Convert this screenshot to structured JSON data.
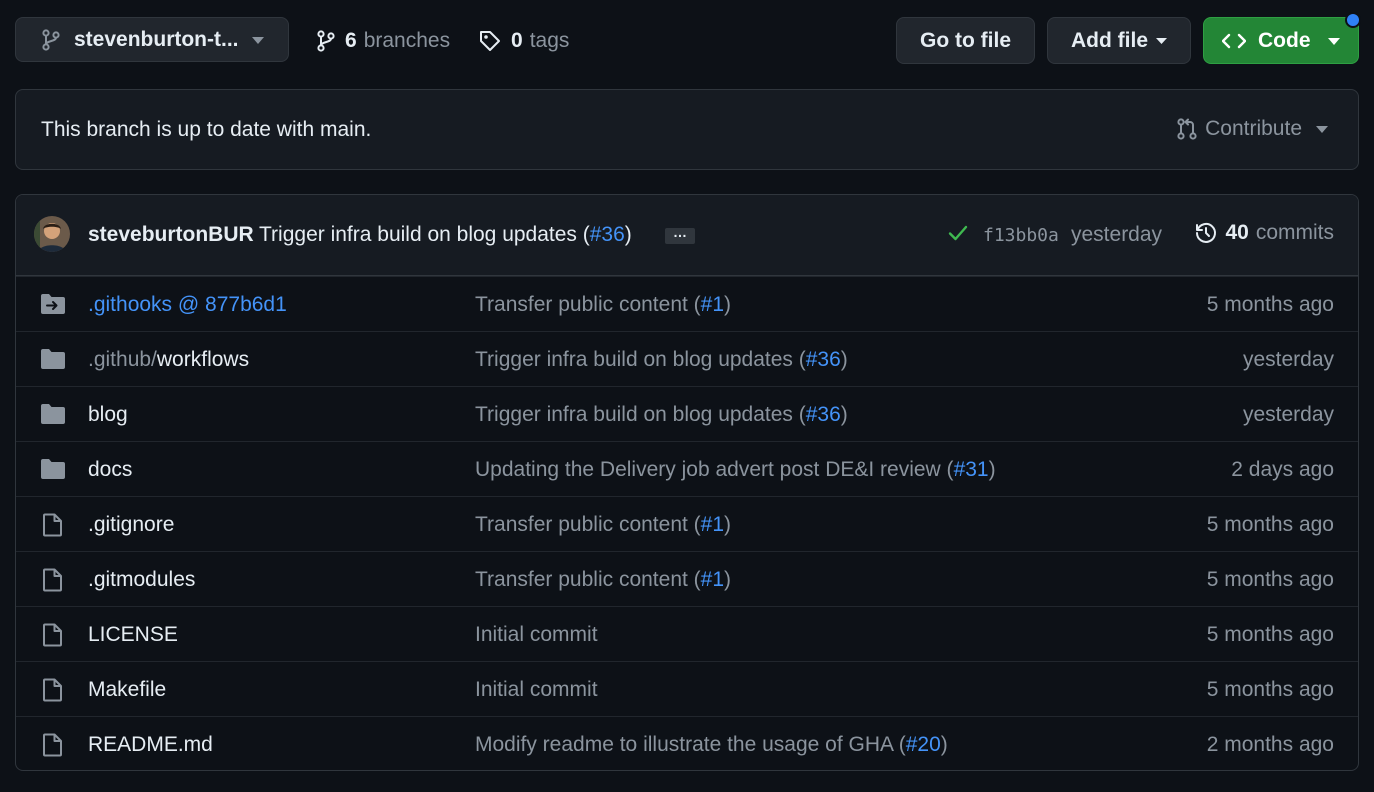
{
  "toolbar": {
    "branch_name": "stevenburton-t...",
    "branches_count": "6",
    "branches_label": "branches",
    "tags_count": "0",
    "tags_label": "tags",
    "go_to_file": "Go to file",
    "add_file": "Add file",
    "code": "Code"
  },
  "status": {
    "text": "This branch is up to date with main.",
    "contribute": "Contribute"
  },
  "latest_commit": {
    "author": "steveburtonBUR",
    "message": "Trigger infra build on blog updates (",
    "pr": "#36",
    "message_end": ")",
    "ellipsis": "…",
    "sha": "f13bb0a",
    "date": "yesterday",
    "commits_count": "40",
    "commits_label": "commits"
  },
  "files": [
    {
      "name": ".githooks @ 877b6d1",
      "type": "submodule",
      "msg": "Transfer public content (",
      "pr": "#1",
      "date": "5 months ago"
    },
    {
      "name_dim": ".github/",
      "name": "workflows",
      "type": "folder",
      "msg": "Trigger infra build on blog updates (",
      "pr": "#36",
      "date": "yesterday"
    },
    {
      "name": "blog",
      "type": "folder",
      "msg": "Trigger infra build on blog updates (",
      "pr": "#36",
      "date": "yesterday"
    },
    {
      "name": "docs",
      "type": "folder",
      "msg": "Updating the Delivery job advert post DE&I review (",
      "pr": "#31",
      "date": "2 days ago"
    },
    {
      "name": ".gitignore",
      "type": "file",
      "msg": "Transfer public content (",
      "pr": "#1",
      "date": "5 months ago"
    },
    {
      "name": ".gitmodules",
      "type": "file",
      "msg": "Transfer public content (",
      "pr": "#1",
      "date": "5 months ago"
    },
    {
      "name": "LICENSE",
      "type": "file",
      "msg": "Initial commit",
      "pr": "",
      "date": "5 months ago"
    },
    {
      "name": "Makefile",
      "type": "file",
      "msg": "Initial commit",
      "pr": "",
      "date": "5 months ago"
    },
    {
      "name": "README.md",
      "type": "file",
      "msg": "Modify readme to illustrate the usage of GHA (",
      "pr": "#20",
      "date": "2 months ago"
    }
  ],
  "colors": {
    "accent": "#4493f8",
    "success": "#3fb950",
    "button_green": "#238636"
  }
}
